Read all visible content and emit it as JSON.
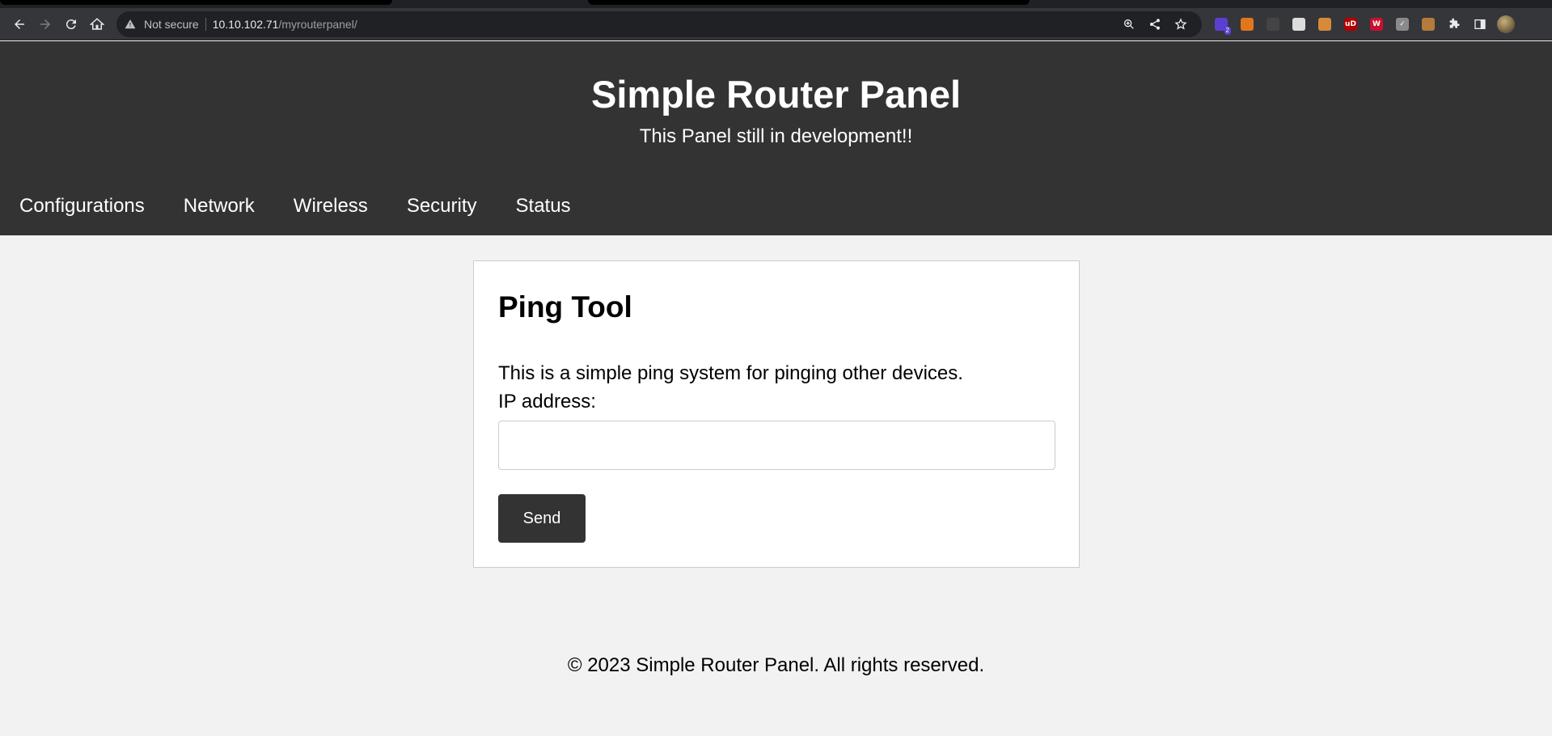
{
  "browser": {
    "url_host": "10.10.102.71",
    "url_path": "/myrouterpanel/",
    "security_label": "Not secure",
    "extensions": [
      {
        "icon": "ublock-icon",
        "color": "#5b3fd1",
        "badge": "2",
        "glyph": ""
      },
      {
        "icon": "metamask-icon",
        "color": "#e2761b",
        "badge": "",
        "glyph": ""
      },
      {
        "icon": "hat-icon",
        "color": "#444444",
        "badge": "",
        "glyph": ""
      },
      {
        "icon": "cookie-multi-icon",
        "color": "#dddddd",
        "badge": "",
        "glyph": ""
      },
      {
        "icon": "cookie-icon",
        "color": "#d68a3a",
        "badge": "",
        "glyph": ""
      },
      {
        "icon": "ublock-origin-icon",
        "color": "#b30000",
        "badge": "",
        "glyph": "uD"
      },
      {
        "icon": "wappalyzer-icon",
        "color": "#c8102e",
        "badge": "",
        "glyph": "W"
      },
      {
        "icon": "checklist-icon",
        "color": "#8a8a8a",
        "badge": "",
        "glyph": "✓"
      },
      {
        "icon": "cookie-editor-icon",
        "color": "#b57a3c",
        "badge": "",
        "glyph": ""
      }
    ]
  },
  "site": {
    "title": "Simple Router Panel",
    "tagline": "This Panel still in development!!",
    "nav": [
      {
        "label": "Configurations"
      },
      {
        "label": "Network"
      },
      {
        "label": "Wireless"
      },
      {
        "label": "Security"
      },
      {
        "label": "Status"
      }
    ]
  },
  "ping": {
    "heading": "Ping Tool",
    "description": "This is a simple ping system for pinging other devices.",
    "ip_label": "IP address:",
    "ip_value": "",
    "send_label": "Send"
  },
  "footer": {
    "text": "© 2023 Simple Router Panel. All rights reserved."
  }
}
